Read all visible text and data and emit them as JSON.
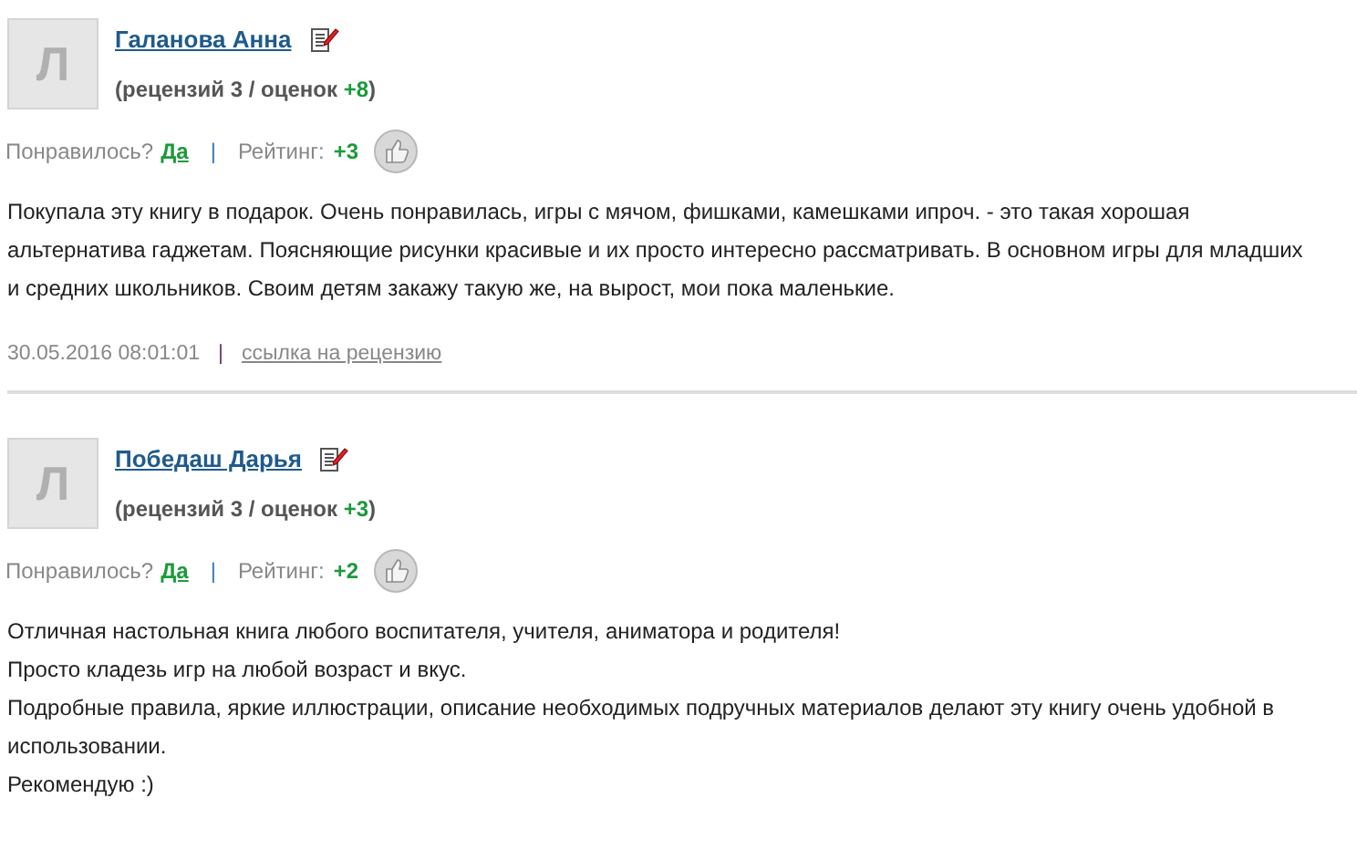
{
  "reviews": [
    {
      "avatar_letter": "Л",
      "author": "Галанова Анна",
      "stats_label": "(рецензий 3 / оценок",
      "stats_score": "+8",
      "stats_close": ")",
      "liked_label": "Понравилось?",
      "liked_link": "Да",
      "separator": "|",
      "rating_label": "Рейтинг:",
      "rating": "+3",
      "body": [
        "Покупала эту книгу в подарок. Очень понравилась, игры с мячом, фишками, камешками ипроч. - это такая хорошая альтернатива гаджетам. Поясняющие рисунки красивые и их просто интересно рассматривать. В основном игры для младших и средних школьников. Своим детям закажу такую же, на вырост, мои пока маленькие."
      ],
      "date": "30.05.2016 08:01:01",
      "footer_separator": "|",
      "permalink": "ссылка на рецензию"
    },
    {
      "avatar_letter": "Л",
      "author": "Победаш Дарья",
      "stats_label": "(рецензий 3 / оценок",
      "stats_score": "+3",
      "stats_close": ")",
      "liked_label": "Понравилось?",
      "liked_link": "Да",
      "separator": "|",
      "rating_label": "Рейтинг:",
      "rating": "+2",
      "body": [
        "Отличная настольная книга любого воспитателя, учителя, аниматора и родителя!",
        "Просто кладезь игр на любой возраст и вкус.",
        "Подробные правила, яркие иллюстрации, описание необходимых подручных материалов делают эту книгу очень удобной в использовании.",
        "Рекомендую :)"
      ]
    }
  ]
}
